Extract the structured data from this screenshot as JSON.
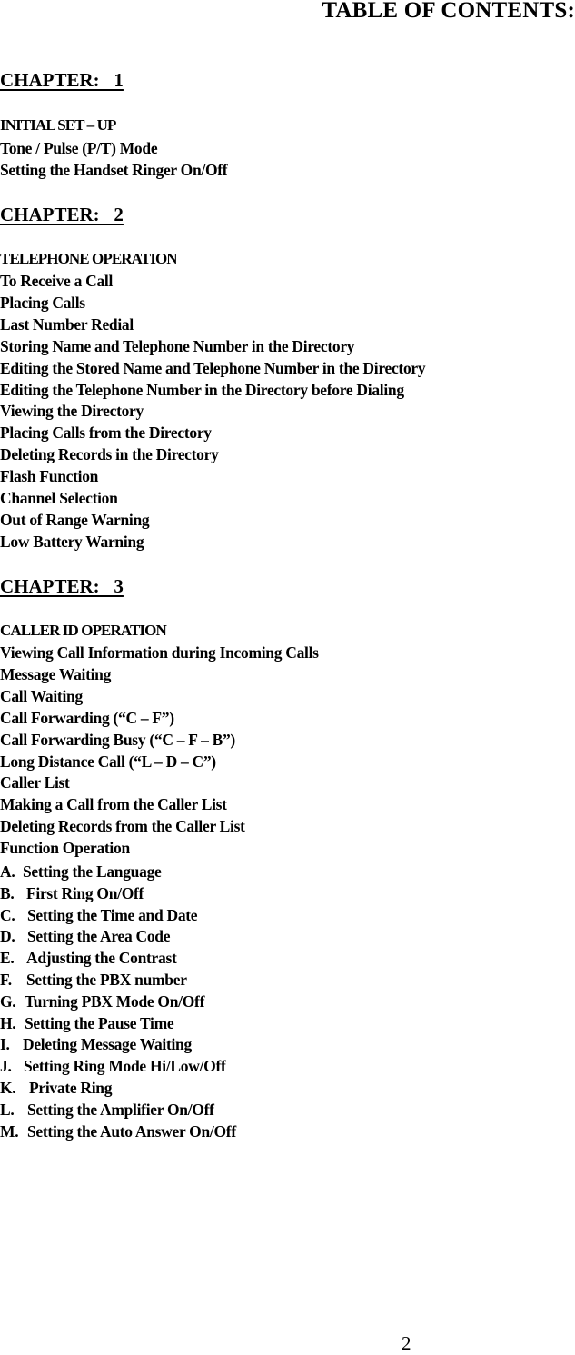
{
  "title": "TABLE OF CONTENTS:",
  "chapters": [
    {
      "heading": "CHAPTER:   1",
      "section": "INITIAL SET – UP",
      "items": [
        "Tone / Pulse (P/T) Mode",
        "Setting the Handset Ringer On/Off"
      ]
    },
    {
      "heading": "CHAPTER:   2",
      "section": "TELEPHONE OPERATION",
      "items": [
        "To Receive a Call",
        "Placing Calls",
        "Last Number Redial",
        "Storing Name and Telephone Number in the Directory",
        "Editing the Stored Name and Telephone Number in the Directory",
        "Editing the Telephone Number in the Directory before Dialing",
        "Viewing the Directory",
        "Placing Calls from the Directory",
        "Deleting Records in the Directory",
        "Flash Function",
        "Channel Selection",
        "Out of Range Warning",
        "Low Battery Warning"
      ]
    },
    {
      "heading": "CHAPTER:   3",
      "section": "CALLER ID OPERATION",
      "items": [
        "Viewing Call Information during Incoming Calls",
        "Message Waiting",
        "Call Waiting",
        "Call Forwarding (“C – F”)",
        "Call Forwarding Busy (“C – F – B”)",
        "Long Distance Call (“L – D – C”)",
        "Caller List",
        "Making a Call from the Caller List",
        "Deleting Records from the Caller List",
        "Function Operation"
      ],
      "function_items": [
        {
          "letter": "A.",
          "label": "Setting the Language"
        },
        {
          "letter": "B.",
          "label": "First Ring On/Off"
        },
        {
          "letter": "C.",
          "label": "Setting the Time and Date"
        },
        {
          "letter": "D.",
          "label": "Setting the Area Code"
        },
        {
          "letter": "E.",
          "label": "Adjusting the Contrast"
        },
        {
          "letter": "F.",
          "label": "Setting the PBX number"
        },
        {
          "letter": "G.",
          "label": "Turning PBX Mode On/Off"
        },
        {
          "letter": "H.",
          "label": "Setting the Pause Time"
        },
        {
          "letter": "I.",
          "label": "Deleting Message Waiting"
        },
        {
          "letter": "J.",
          "label": "Setting Ring Mode Hi/Low/Off"
        },
        {
          "letter": "K.",
          "label": "Private Ring"
        },
        {
          "letter": "L.",
          "label": "Setting the Amplifier On/Off"
        },
        {
          "letter": "M.",
          "label": "Setting the Auto Answer On/Off"
        }
      ]
    }
  ],
  "page_number": "2"
}
